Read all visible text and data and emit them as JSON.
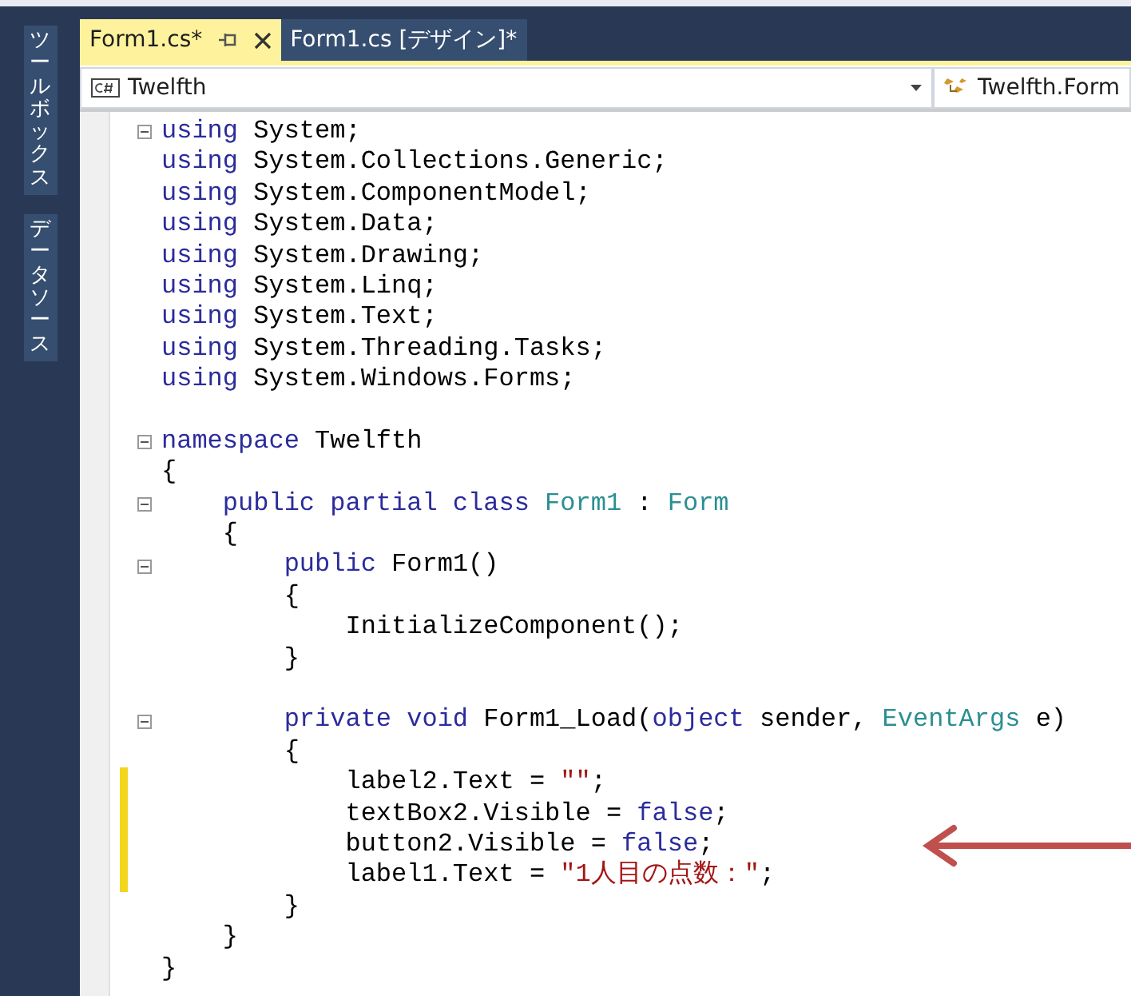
{
  "side_tabs": [
    {
      "label": "ツールボックス"
    },
    {
      "label": "データソース"
    }
  ],
  "tabs": [
    {
      "label": "Form1.cs*",
      "selected": true
    },
    {
      "label": "Form1.cs [デザイン]*",
      "selected": false
    }
  ],
  "nav": {
    "left": "Twelfth",
    "right": "Twelfth.Form"
  },
  "lines": [
    {
      "fold": true,
      "changed": false,
      "tokens": [
        {
          "kind": "keyword",
          "t": "using "
        },
        {
          "kind": "plain",
          "t": "System;"
        }
      ]
    },
    {
      "fold": false,
      "changed": false,
      "tokens": [
        {
          "kind": "keyword",
          "t": "using "
        },
        {
          "kind": "plain",
          "t": "System.Collections.Generic;"
        }
      ]
    },
    {
      "fold": false,
      "changed": false,
      "tokens": [
        {
          "kind": "keyword",
          "t": "using "
        },
        {
          "kind": "plain",
          "t": "System.ComponentModel;"
        }
      ]
    },
    {
      "fold": false,
      "changed": false,
      "tokens": [
        {
          "kind": "keyword",
          "t": "using "
        },
        {
          "kind": "plain",
          "t": "System.Data;"
        }
      ]
    },
    {
      "fold": false,
      "changed": false,
      "tokens": [
        {
          "kind": "keyword",
          "t": "using "
        },
        {
          "kind": "plain",
          "t": "System.Drawing;"
        }
      ]
    },
    {
      "fold": false,
      "changed": false,
      "tokens": [
        {
          "kind": "keyword",
          "t": "using "
        },
        {
          "kind": "plain",
          "t": "System.Linq;"
        }
      ]
    },
    {
      "fold": false,
      "changed": false,
      "tokens": [
        {
          "kind": "keyword",
          "t": "using "
        },
        {
          "kind": "plain",
          "t": "System.Text;"
        }
      ]
    },
    {
      "fold": false,
      "changed": false,
      "tokens": [
        {
          "kind": "keyword",
          "t": "using "
        },
        {
          "kind": "plain",
          "t": "System.Threading.Tasks;"
        }
      ]
    },
    {
      "fold": false,
      "changed": false,
      "tokens": [
        {
          "kind": "keyword",
          "t": "using "
        },
        {
          "kind": "plain",
          "t": "System.Windows.Forms;"
        }
      ]
    },
    {
      "fold": false,
      "changed": false
    },
    {
      "fold": true,
      "changed": false,
      "tokens": [
        {
          "kind": "keyword",
          "t": "namespace "
        },
        {
          "kind": "plain",
          "t": "Twelfth"
        }
      ]
    },
    {
      "fold": false,
      "changed": false,
      "tokens": [
        {
          "kind": "plain",
          "t": "{"
        }
      ]
    },
    {
      "fold": true,
      "changed": false,
      "tokens": [
        {
          "kind": "keyword",
          "t": "    public partial class "
        },
        {
          "kind": "type",
          "t": "Form1"
        },
        {
          "kind": "plain",
          "t": " : "
        },
        {
          "kind": "type",
          "t": "Form"
        }
      ]
    },
    {
      "fold": false,
      "changed": false,
      "tokens": [
        {
          "kind": "plain",
          "t": "    {"
        }
      ]
    },
    {
      "fold": true,
      "changed": false,
      "tokens": [
        {
          "kind": "keyword",
          "t": "        public "
        },
        {
          "kind": "plain",
          "t": "Form1()"
        }
      ]
    },
    {
      "fold": false,
      "changed": false,
      "tokens": [
        {
          "kind": "plain",
          "t": "        {"
        }
      ]
    },
    {
      "fold": false,
      "changed": false,
      "tokens": [
        {
          "kind": "plain",
          "t": "            InitializeComponent();"
        }
      ]
    },
    {
      "fold": false,
      "changed": false,
      "tokens": [
        {
          "kind": "plain",
          "t": "        }"
        }
      ]
    },
    {
      "fold": false,
      "changed": false
    },
    {
      "fold": true,
      "changed": false,
      "tokens": [
        {
          "kind": "keyword",
          "t": "        private void "
        },
        {
          "kind": "plain",
          "t": "Form1_Load("
        },
        {
          "kind": "keyword",
          "t": "object "
        },
        {
          "kind": "plain",
          "t": "sender, "
        },
        {
          "kind": "type",
          "t": "EventArgs"
        },
        {
          "kind": "plain",
          "t": " e)"
        }
      ]
    },
    {
      "fold": false,
      "changed": false,
      "tokens": [
        {
          "kind": "plain",
          "t": "        {"
        }
      ]
    },
    {
      "fold": false,
      "changed": true,
      "tokens": [
        {
          "kind": "plain",
          "t": "            label2.Text = "
        },
        {
          "kind": "string",
          "t": "\"\""
        },
        {
          "kind": "plain",
          "t": ";"
        }
      ]
    },
    {
      "fold": false,
      "changed": true,
      "tokens": [
        {
          "kind": "plain",
          "t": "            textBox2.Visible = "
        },
        {
          "kind": "keyword",
          "t": "false"
        },
        {
          "kind": "plain",
          "t": ";"
        }
      ]
    },
    {
      "fold": false,
      "changed": true,
      "tokens": [
        {
          "kind": "plain",
          "t": "            button2.Visible = "
        },
        {
          "kind": "keyword",
          "t": "false"
        },
        {
          "kind": "plain",
          "t": ";"
        }
      ]
    },
    {
      "fold": false,
      "changed": true,
      "tokens": [
        {
          "kind": "plain",
          "t": "            label1.Text = "
        },
        {
          "kind": "string",
          "t": "\"1人目の点数：\""
        },
        {
          "kind": "plain",
          "t": ";"
        }
      ]
    },
    {
      "fold": false,
      "changed": false,
      "tokens": [
        {
          "kind": "plain",
          "t": "        }"
        }
      ]
    },
    {
      "fold": false,
      "changed": false,
      "tokens": [
        {
          "kind": "plain",
          "t": "    }"
        }
      ]
    },
    {
      "fold": false,
      "changed": false,
      "tokens": [
        {
          "kind": "plain",
          "t": "}"
        }
      ]
    }
  ]
}
